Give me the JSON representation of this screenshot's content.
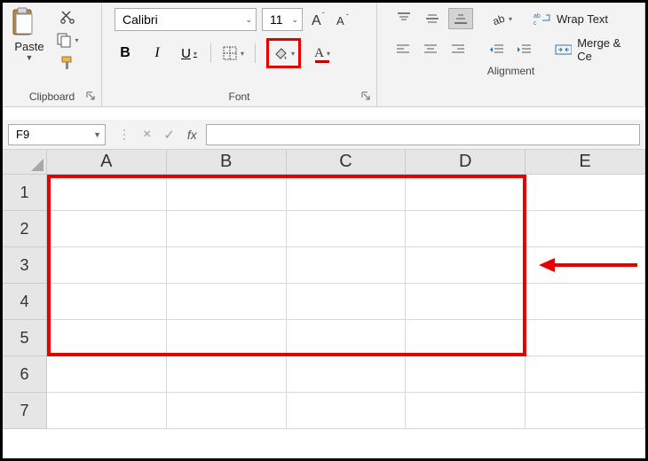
{
  "ribbon": {
    "clipboard": {
      "paste_label": "Paste",
      "group_label": "Clipboard"
    },
    "font": {
      "font_name": "Calibri",
      "font_size": "11",
      "bold": "B",
      "italic": "I",
      "underline": "U",
      "group_label": "Font"
    },
    "alignment": {
      "wrap_text": "Wrap Text",
      "merge_center": "Merge & Ce",
      "group_label": "Alignment"
    }
  },
  "formula_bar": {
    "name_box_value": "F9",
    "fx_label": "fx"
  },
  "sheet": {
    "columns": [
      "A",
      "B",
      "C",
      "D",
      "E"
    ],
    "rows": [
      "1",
      "2",
      "3",
      "4",
      "5",
      "6",
      "7"
    ]
  }
}
